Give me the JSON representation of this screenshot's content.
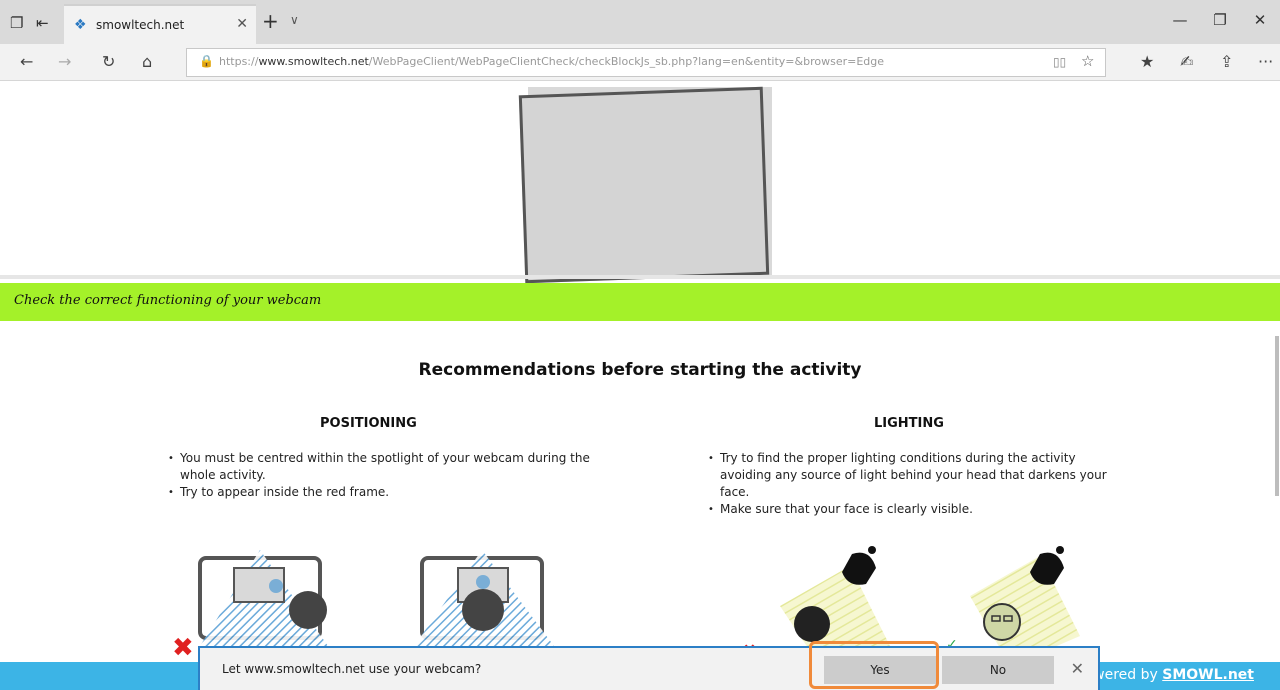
{
  "browser": {
    "tab_title": "smowltech.net",
    "tab_close_icon": "close-icon",
    "new_tab_glyph": "+",
    "tab_menu_glyph": "∨",
    "address": {
      "prefix": "https://",
      "host": "www.smowltech.net",
      "path": "/WebPageClient/WebPageClientCheck/checkBlockJs_sb.php?lang=en&entity=&browser=Edge"
    },
    "window": {
      "minimize": "—",
      "restore": "❐",
      "close": "✕"
    },
    "nav": {
      "back": "←",
      "forward": "→",
      "refresh": "↻",
      "home": "⌂"
    },
    "toolbar": {
      "reading_view": "▯▯",
      "favorite": "☆",
      "favorites_list": "★",
      "notes": "✍",
      "share": "⇪",
      "more": "···"
    }
  },
  "page": {
    "banner_text": "Check the correct functioning of your webcam",
    "heading": "Recommendations before starting the activity",
    "positioning": {
      "title": "POSITIONING",
      "bullets": [
        "You must be centred within the spotlight of your webcam during the whole activity.",
        "Try to appear inside the red frame."
      ]
    },
    "lighting": {
      "title": "LIGHTING",
      "bullets": [
        "Try to find the proper lighting conditions during the activity avoiding any source of light behind your head that darkens your face.",
        "Make sure that your face is clearly visible."
      ]
    },
    "powered_prefix": "wered by ",
    "powered_brand": "SMOWL.net"
  },
  "notification": {
    "message": "Let www.smowltech.net use your webcam?",
    "yes_label": "Yes",
    "no_label": "No",
    "close_glyph": "✕"
  },
  "colors": {
    "banner": "#a4f129",
    "bottom_bar": "#3cb4e6",
    "highlight": "#f08a3a",
    "notification_border": "#2c7fc6"
  }
}
